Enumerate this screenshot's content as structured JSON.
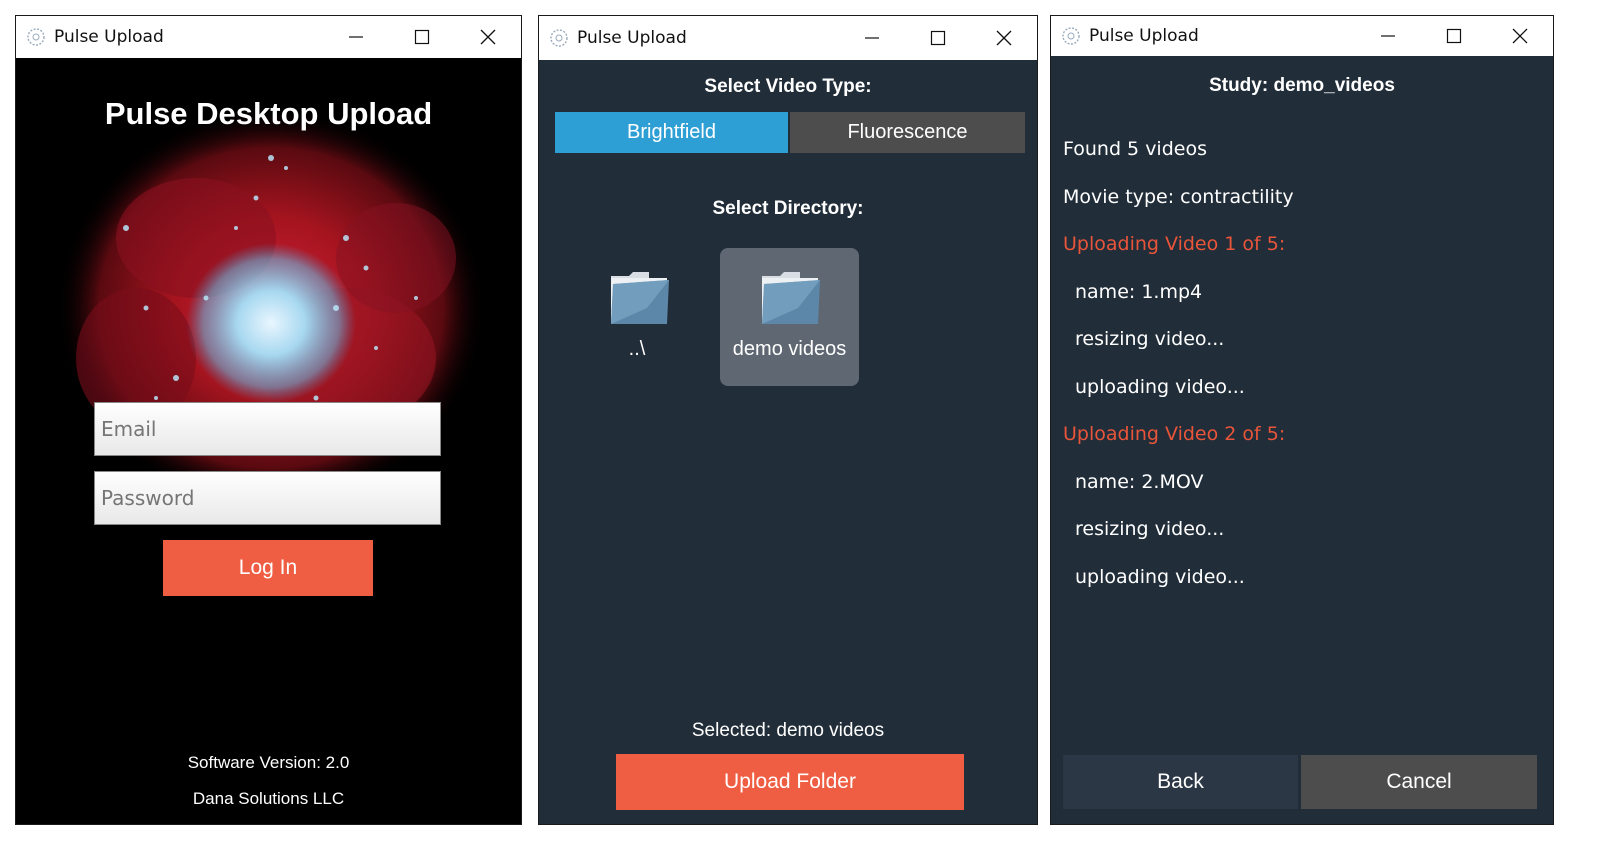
{
  "windows": [
    {
      "title": "Pulse Upload",
      "heading": "Pulse Desktop Upload",
      "email_placeholder": "Email",
      "password_placeholder": "Password",
      "login_label": "Log In",
      "version": "Software Version: 2.0",
      "company": "Dana Solutions LLC"
    },
    {
      "title": "Pulse Upload",
      "video_type_label": "Select Video Type:",
      "video_types": [
        "Brightfield",
        "Fluorescence"
      ],
      "selected_video_type": "Brightfield",
      "directory_label": "Select Directory:",
      "folders": [
        {
          "name": "..\\",
          "selected": false
        },
        {
          "name": "demo videos",
          "selected": true
        }
      ],
      "selected_text": "Selected: demo videos",
      "upload_label": "Upload Folder"
    },
    {
      "title": "Pulse Upload",
      "study_label": "Study: demo_videos",
      "log": [
        {
          "text": "Found 5 videos",
          "style": "normal"
        },
        {
          "text": "Movie type: contractility",
          "style": "normal"
        },
        {
          "text": "Uploading Video 1 of 5:",
          "style": "highlight"
        },
        {
          "text": "name: 1.mp4",
          "style": "indent"
        },
        {
          "text": "resizing video...",
          "style": "indent"
        },
        {
          "text": "uploading video...",
          "style": "indent"
        },
        {
          "text": "Uploading Video 2 of 5:",
          "style": "highlight"
        },
        {
          "text": "name: 2.MOV",
          "style": "indent"
        },
        {
          "text": "resizing video...",
          "style": "indent"
        },
        {
          "text": "uploading video...",
          "style": "indent"
        }
      ],
      "back_label": "Back",
      "cancel_label": "Cancel"
    }
  ],
  "colors": {
    "accent_orange": "#ef5d42",
    "accent_blue": "#2e9fd4",
    "dark_bg": "#212d39",
    "log_highlight": "#e8553a"
  },
  "icons": [
    "app-logo-icon",
    "minimize-icon",
    "maximize-icon",
    "close-icon",
    "folder-icon"
  ]
}
